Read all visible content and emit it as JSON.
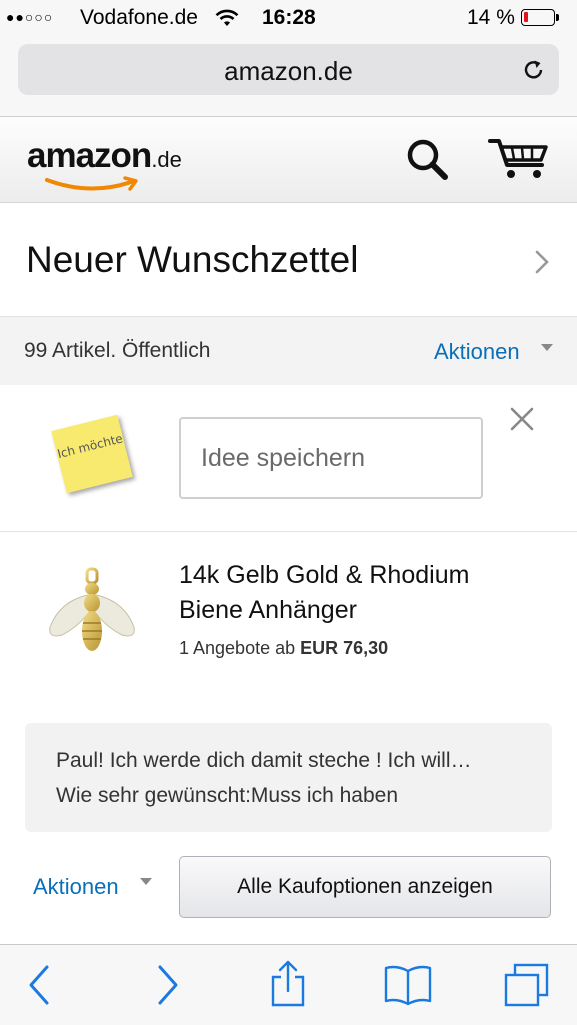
{
  "status_bar": {
    "signal": "●●○○○",
    "carrier": "Vodafone.de",
    "wifi_icon": "wifi-icon",
    "time": "16:28",
    "battery_percent": "14 %",
    "battery_level": 0.14,
    "battery_color": "#e0161b"
  },
  "browser": {
    "url": "amazon.de",
    "reload_icon": "reload-icon"
  },
  "header": {
    "logo_main": "amazon",
    "logo_tld": ".de",
    "search_icon": "search-icon",
    "cart_icon": "cart-icon"
  },
  "wishlist": {
    "title": "Neuer Wunschzettel",
    "info": "99 Artikel. Öffentlich",
    "actions_label": "Aktionen"
  },
  "idea": {
    "sticky_text": "Ich möchte",
    "input_placeholder": "Idee speichern",
    "input_value": ""
  },
  "product": {
    "title": "14k Gelb Gold & Rhodium Biene Anhänger",
    "offer_prefix": "1 Angebote ab ",
    "price": "EUR 76,30",
    "comment": "Paul! Ich werde dich damit steche ! Ich will…",
    "desire": "Wie sehr gewünscht:Muss ich haben",
    "actions_label": "Aktionen",
    "buy_options_label": "Alle Kaufoptionen anzeigen"
  },
  "toolbar": {
    "items": [
      "back-icon",
      "forward-icon",
      "share-icon",
      "bookmarks-icon",
      "tabs-icon"
    ]
  },
  "colors": {
    "link": "#0b6fb8",
    "amazon_orange": "#f08804"
  }
}
